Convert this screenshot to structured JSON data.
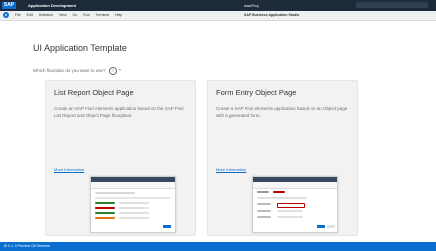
{
  "topbar": {
    "logo": "SAP",
    "app_title": "Application Development",
    "project": "ownProj"
  },
  "menubar": {
    "items": [
      "File",
      "Edit",
      "Selection",
      "View",
      "Go",
      "Run",
      "Terminal",
      "Help"
    ],
    "studio_title": "SAP Business Application Studio"
  },
  "page": {
    "title": "UI Application Template",
    "question": "Which floorplan do you want to use?",
    "help_icon": "?",
    "required_mark": "*"
  },
  "cards": [
    {
      "title": "List Report Object Page",
      "description": "Create an SAP Fiori elements application based on the SAP Fiori List Report and Object Page floorplans.",
      "link": "More Information"
    },
    {
      "title": "Form Entry Object Page",
      "description": "Create a SAP Fiori elements application based on an Object page with a generated form.",
      "link": "More Information"
    }
  ],
  "statusbar": {
    "text": "Ø 0  ⚠ 0   Preview   Git   Terminal"
  },
  "colors": {
    "shell": "#1c2a3a",
    "accent": "#0a6ed1",
    "card_bg": "#f2f2f2"
  }
}
